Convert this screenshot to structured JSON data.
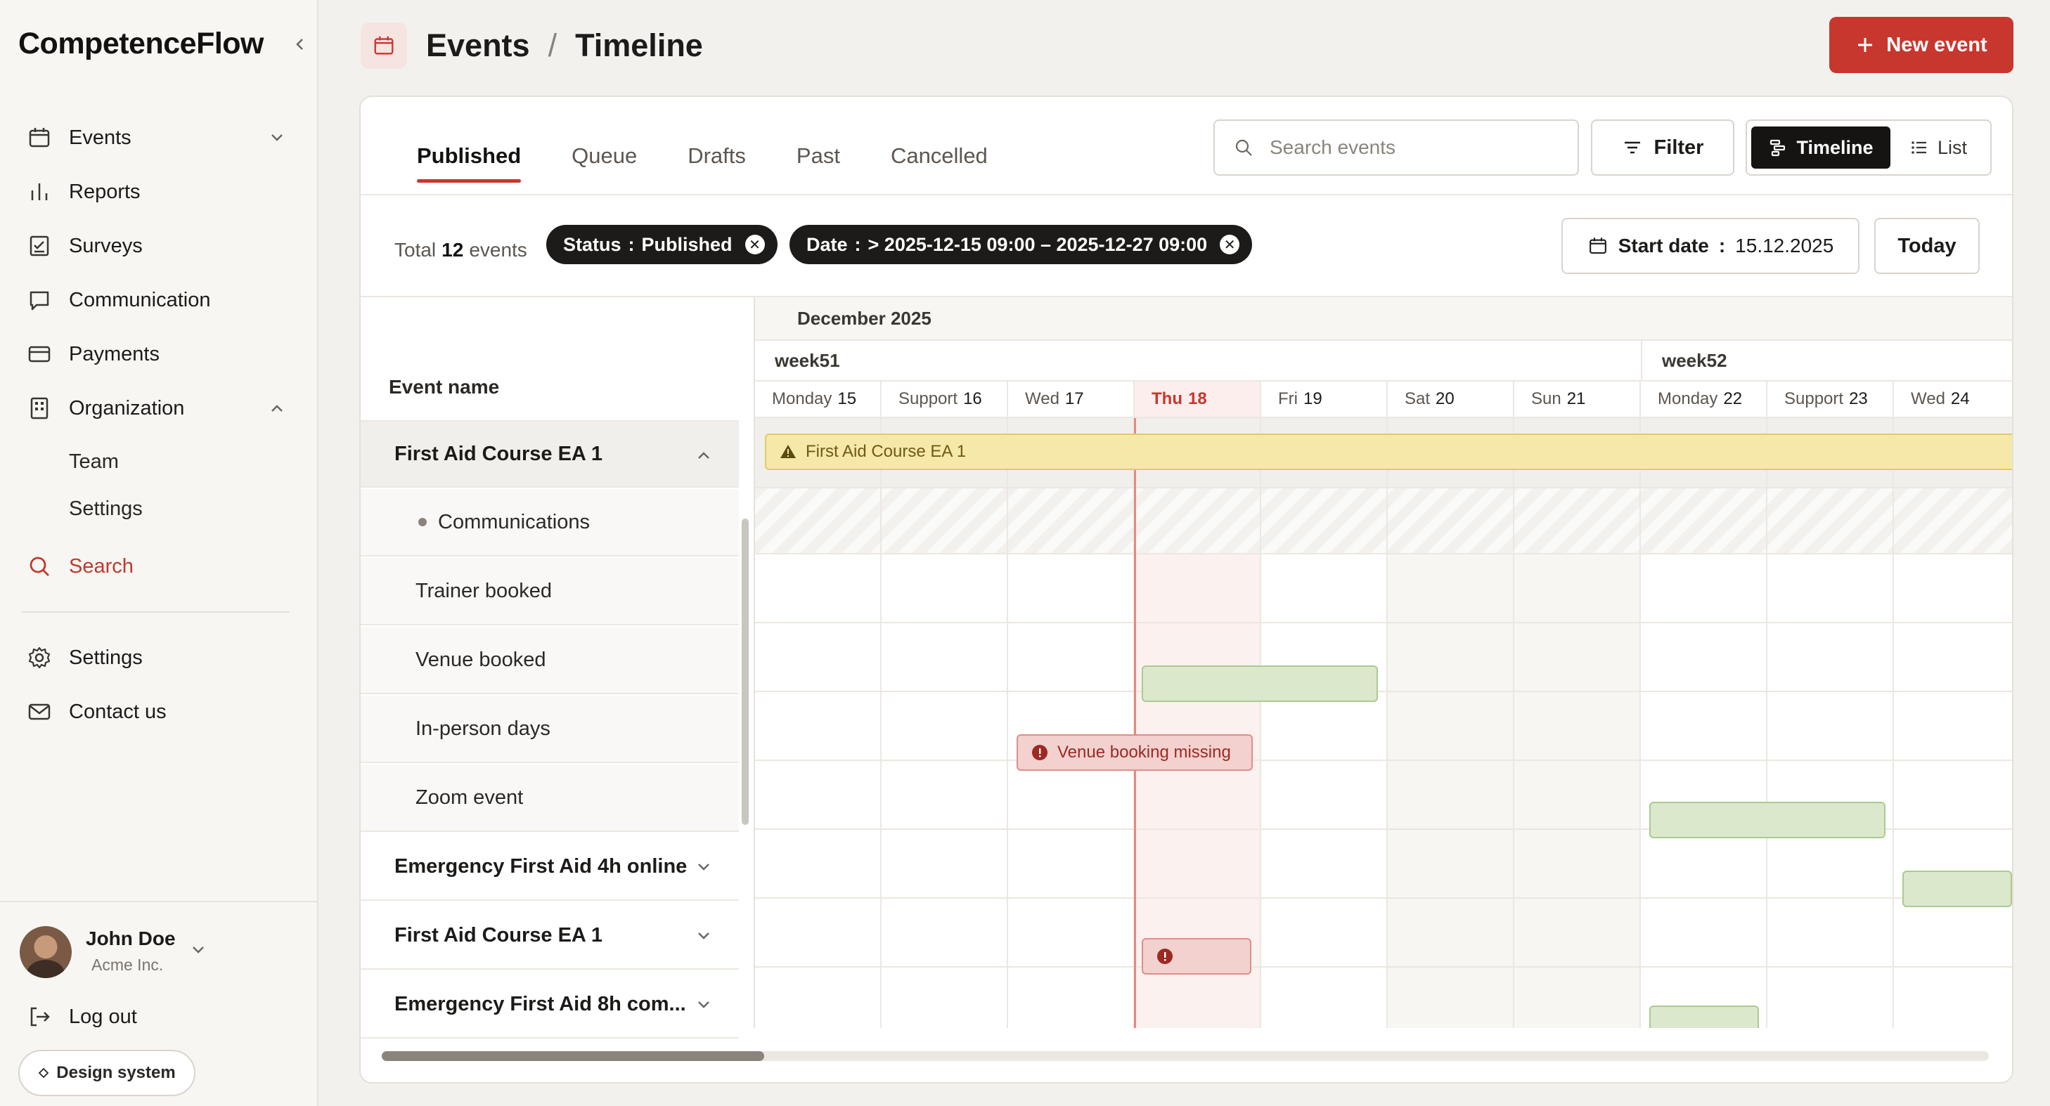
{
  "app": {
    "brand": "CompetenceFlow"
  },
  "sidebar": {
    "items": [
      {
        "label": "Events",
        "icon": "calendar-icon"
      },
      {
        "label": "Reports",
        "icon": "bar-chart-icon"
      },
      {
        "label": "Surveys",
        "icon": "checklist-icon"
      },
      {
        "label": "Communication",
        "icon": "chat-icon"
      },
      {
        "label": "Payments",
        "icon": "credit-card-icon"
      },
      {
        "label": "Organization",
        "icon": "building-icon"
      }
    ],
    "sub_items": [
      "Team",
      "Settings"
    ],
    "search_label": "Search",
    "bottom_items": [
      {
        "label": "Settings",
        "icon": "gear-icon"
      },
      {
        "label": "Contact us",
        "icon": "mail-icon"
      }
    ],
    "user": {
      "name": "John Doe",
      "org": "Acme Inc."
    },
    "logout_label": "Log out",
    "design_system_label": "Design system"
  },
  "header": {
    "crumb_1": "Events",
    "separator": "/",
    "crumb_2": "Timeline",
    "new_event_label": "New event"
  },
  "tabs": [
    "Published",
    "Queue",
    "Drafts",
    "Past",
    "Cancelled"
  ],
  "active_tab": "Published",
  "toolbar": {
    "search_placeholder": "Search events",
    "filter_label": "Filter",
    "view_timeline": "Timeline",
    "view_list": "List"
  },
  "filters": {
    "total_prefix": "Total",
    "total_count": "12",
    "total_suffix": "events",
    "chips": [
      {
        "key": "Status",
        "sep": ":",
        "value": "Published"
      },
      {
        "key": "Date",
        "sep": ":",
        "value": "> 2025-12-15 09:00 – 2025-12-27 09:00"
      }
    ],
    "start_date_label": "Start date",
    "start_date_sep": ":",
    "start_date_value": "15.12.2025",
    "today_label": "Today"
  },
  "timeline": {
    "column_header": "Event name",
    "month": "December 2025",
    "weeks": [
      "week51",
      "week52"
    ],
    "days": [
      {
        "name": "Monday",
        "num": "15"
      },
      {
        "name": "Support",
        "num": "16"
      },
      {
        "name": "Wed",
        "num": "17"
      },
      {
        "name": "Thu",
        "num": "18"
      },
      {
        "name": "Fri",
        "num": "19"
      },
      {
        "name": "Sat",
        "num": "20"
      },
      {
        "name": "Sun",
        "num": "21"
      },
      {
        "name": "Monday",
        "num": "22"
      },
      {
        "name": "Support",
        "num": "23"
      },
      {
        "name": "Wed",
        "num": "24"
      }
    ],
    "rows": [
      {
        "label": "First Aid Course EA 1",
        "type": "parent",
        "expanded": true
      },
      {
        "label": "Communications",
        "type": "child-dot"
      },
      {
        "label": "Trainer booked",
        "type": "child"
      },
      {
        "label": "Venue booked",
        "type": "child"
      },
      {
        "label": "In-person days",
        "type": "child"
      },
      {
        "label": "Zoom event",
        "type": "child"
      },
      {
        "label": "Emergency First Aid 4h online",
        "type": "parent",
        "expanded": false
      },
      {
        "label": "First Aid Course EA 1",
        "type": "parent",
        "expanded": false
      },
      {
        "label": "Emergency First Aid 8h com...",
        "type": "parent",
        "expanded": false
      }
    ],
    "bars": [
      {
        "label": "First Aid Course EA 1",
        "status": "warning"
      },
      {
        "label": "Venue booking missing",
        "status": "error"
      }
    ]
  },
  "colors": {
    "accent": "#c8372d",
    "success_bar": "#dbe8cc",
    "warning_bar": "#f6e8a9",
    "error_bar": "#f2d1cf"
  }
}
